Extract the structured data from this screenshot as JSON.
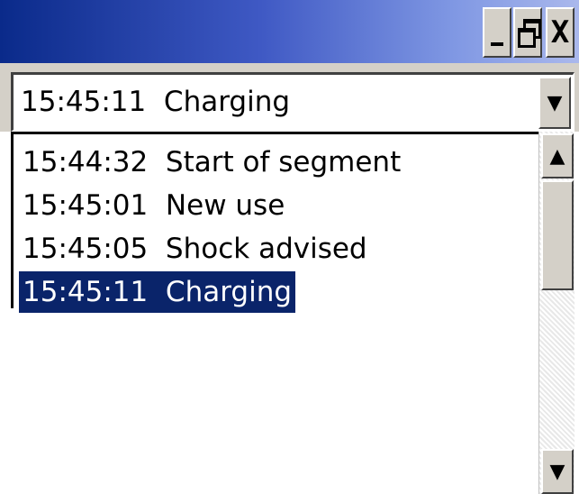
{
  "window": {
    "buttons": {
      "minimize_icon": "minimize-icon",
      "restore_icon": "restore-icon",
      "close_label": "X"
    }
  },
  "combo": {
    "selected_value": "15:45:11  Charging",
    "dropdown_icon": "▼"
  },
  "list": {
    "items": [
      {
        "time": "15:44:32",
        "label": "15:44:32  Start of segment"
      },
      {
        "time": "15:45:01",
        "label": "15:45:01  New use"
      },
      {
        "time": "15:45:05",
        "label": "15:45:05  Shock advised"
      },
      {
        "time": "15:45:11",
        "label": "15:45:11  Charging",
        "selected": true
      }
    ]
  },
  "scrollbar": {
    "up_icon": "▲",
    "down_icon": "▼"
  },
  "colors": {
    "selection_bg": "#0a246a",
    "titlebar_start": "#0a2a8a",
    "titlebar_end": "#aab8ec",
    "chrome": "#d4d0c8"
  }
}
